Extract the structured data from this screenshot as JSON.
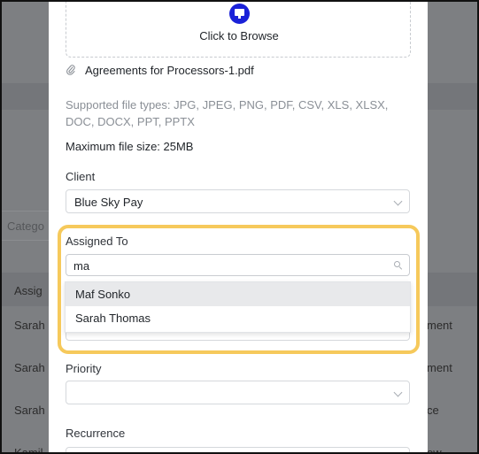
{
  "upload": {
    "icon": "monitor-icon",
    "label": "Click to Browse"
  },
  "attachment": {
    "icon": "paperclip-icon",
    "file_name": "Agreements for Processors-1.pdf"
  },
  "file_info": {
    "supported_types": "Supported file types: JPG, JPEG, PNG, PDF, CSV, XLS, XLSX, DOC, DOCX, PPT, PPTX",
    "max_size": "Maximum file size: 25MB"
  },
  "client": {
    "label": "Client",
    "value": "Blue Sky Pay"
  },
  "assigned_to": {
    "label": "Assigned To",
    "search_value": "ma",
    "options": [
      "Maf Sonko",
      "Sarah Thomas"
    ]
  },
  "priority": {
    "label": "Priority",
    "value": ""
  },
  "recurrence": {
    "label": "Recurrence"
  },
  "background": {
    "category_placeholder": "Catego",
    "column_header": "Assig",
    "rows_left": [
      "Sarah",
      "Sarah",
      "Sarah",
      "Kamil"
    ],
    "rows_right": [
      "ment",
      "ment",
      "ce",
      "ew"
    ]
  },
  "colors": {
    "accent": "#1a21d8",
    "highlight": "#f6c95b",
    "overlay": "#7d7f82"
  }
}
